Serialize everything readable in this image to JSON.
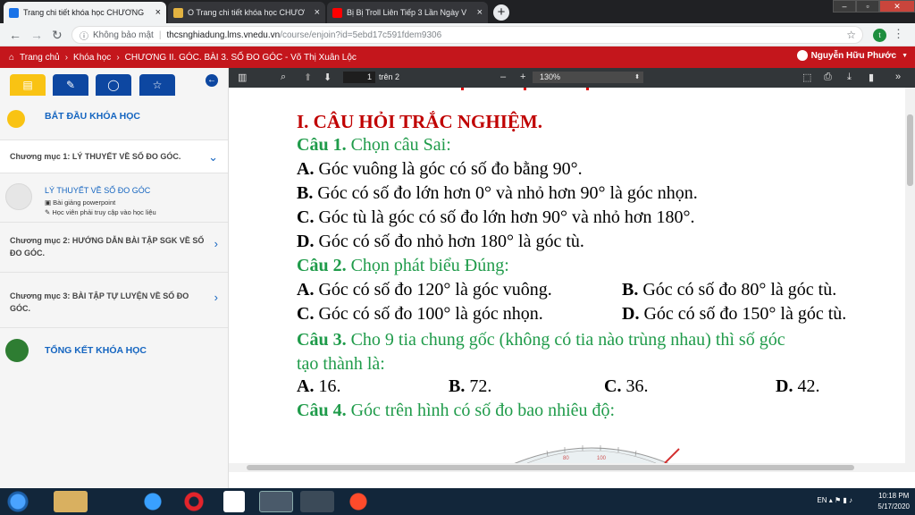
{
  "browser": {
    "tabs": [
      {
        "title": "Trang chi tiết khóa học CHƯƠNG",
        "active": true
      },
      {
        "title": "O Trang chi tiết khóa học CHƯƠ",
        "active": false
      },
      {
        "title": "Bị Bị Troll Liên Tiếp 3 Lần Ngày V",
        "active": false
      }
    ],
    "close_glyph": "×",
    "new_tab_glyph": "+",
    "security_label": "Không bảo mật",
    "url_host": "thcsnghiadung.lms.vnedu.vn",
    "url_path": "/course/enjoin?id=5ebd17c591fdem9306",
    "profile_initial": "t"
  },
  "site": {
    "breadcrumb": [
      "Trang chủ",
      "Khóa học",
      "CHƯƠNG II. GÓC. BÀI 3. SỐ ĐO GÓC - Võ Thị Xuân Lộc"
    ],
    "user_name": "Nguyễn Hữu Phước"
  },
  "sidebar": {
    "start_label": "BẮT ĐẦU KHÓA HỌC",
    "chapter1": "Chương mục 1: LÝ THUYẾT VỀ SỐ ĐO GÓC.",
    "lesson_title": "LÝ THUYẾT VỀ SỐ ĐO GÓC",
    "lesson_type": "Bài giảng powerpoint",
    "lesson_note": "Học viên phải truy cập vào học liệu",
    "chapter2_line1": "Chương mục 2: HƯỚNG DẪN BÀI TẬP SGK VỀ SỐ",
    "chapter2_line2": "ĐO GÓC.",
    "chapter3_line1": "Chương mục 3: BÀI TẬP TỰ LUYỆN VỀ SỐ ĐO",
    "chapter3_line2": "GÓC.",
    "end_label": "TỔNG KẾT KHÓA HỌC"
  },
  "pdf": {
    "page_current": "1",
    "page_total": "trên 2",
    "zoom": "130%"
  },
  "document": {
    "heading": "I. CÂU HỎI TRẮC NGHIỆM.",
    "q1_label": "Câu 1.",
    "q1_text": "Chọn câu Sai:",
    "q1_a_label": "A.",
    "q1_a": "Góc vuông là góc có số đo bằng 90°.",
    "q1_b_label": "B.",
    "q1_b": "Góc có số đo lớn hơn 0° và nhỏ hơn 90° là góc nhọn.",
    "q1_c_label": "C.",
    "q1_c": "Góc tù là góc có số đo lớn hơn 90° và nhỏ hơn 180°.",
    "q1_d_label": "D.",
    "q1_d": "Góc có số đo nhỏ hơn 180° là góc tù.",
    "q2_label": "Câu 2.",
    "q2_text": "Chọn phát biểu Đúng:",
    "q2_a_label": "A.",
    "q2_a": "Góc có số đo 120° là góc vuông.",
    "q2_b_label": "B.",
    "q2_b": "Góc có số đo 80° là góc tù.",
    "q2_c_label": "C.",
    "q2_c": "Góc có số đo 100° là góc nhọn.",
    "q2_d_label": "D.",
    "q2_d": "Góc có số đo 150° là góc tù.",
    "q3_label": "Câu 3.",
    "q3_text_1": "Cho 9 tia chung gốc (không có tia nào trùng nhau) thì số góc",
    "q3_text_2": "tạo thành là:",
    "q3_a_label": "A.",
    "q3_a": "16.",
    "q3_b_label": "B.",
    "q3_b": "72.",
    "q3_c_label": "C.",
    "q3_c": "36.",
    "q3_d_label": "D.",
    "q3_d": "42.",
    "q4_label": "Câu 4.",
    "q4_text": "Góc trên hình có số đo bao nhiêu độ:",
    "protractor_ticks": [
      "80",
      "100"
    ]
  },
  "taskbar": {
    "lang": "EN",
    "time": "10:18 PM",
    "date": "5/17/2020"
  },
  "colors": {
    "site_bar": "#c4161c",
    "heading_red": "#c00000",
    "question_green": "#1f9b4a",
    "sidebar_blue": "#0d47a1",
    "start_dot": "#f9c313",
    "end_dot": "#2e7d32"
  }
}
